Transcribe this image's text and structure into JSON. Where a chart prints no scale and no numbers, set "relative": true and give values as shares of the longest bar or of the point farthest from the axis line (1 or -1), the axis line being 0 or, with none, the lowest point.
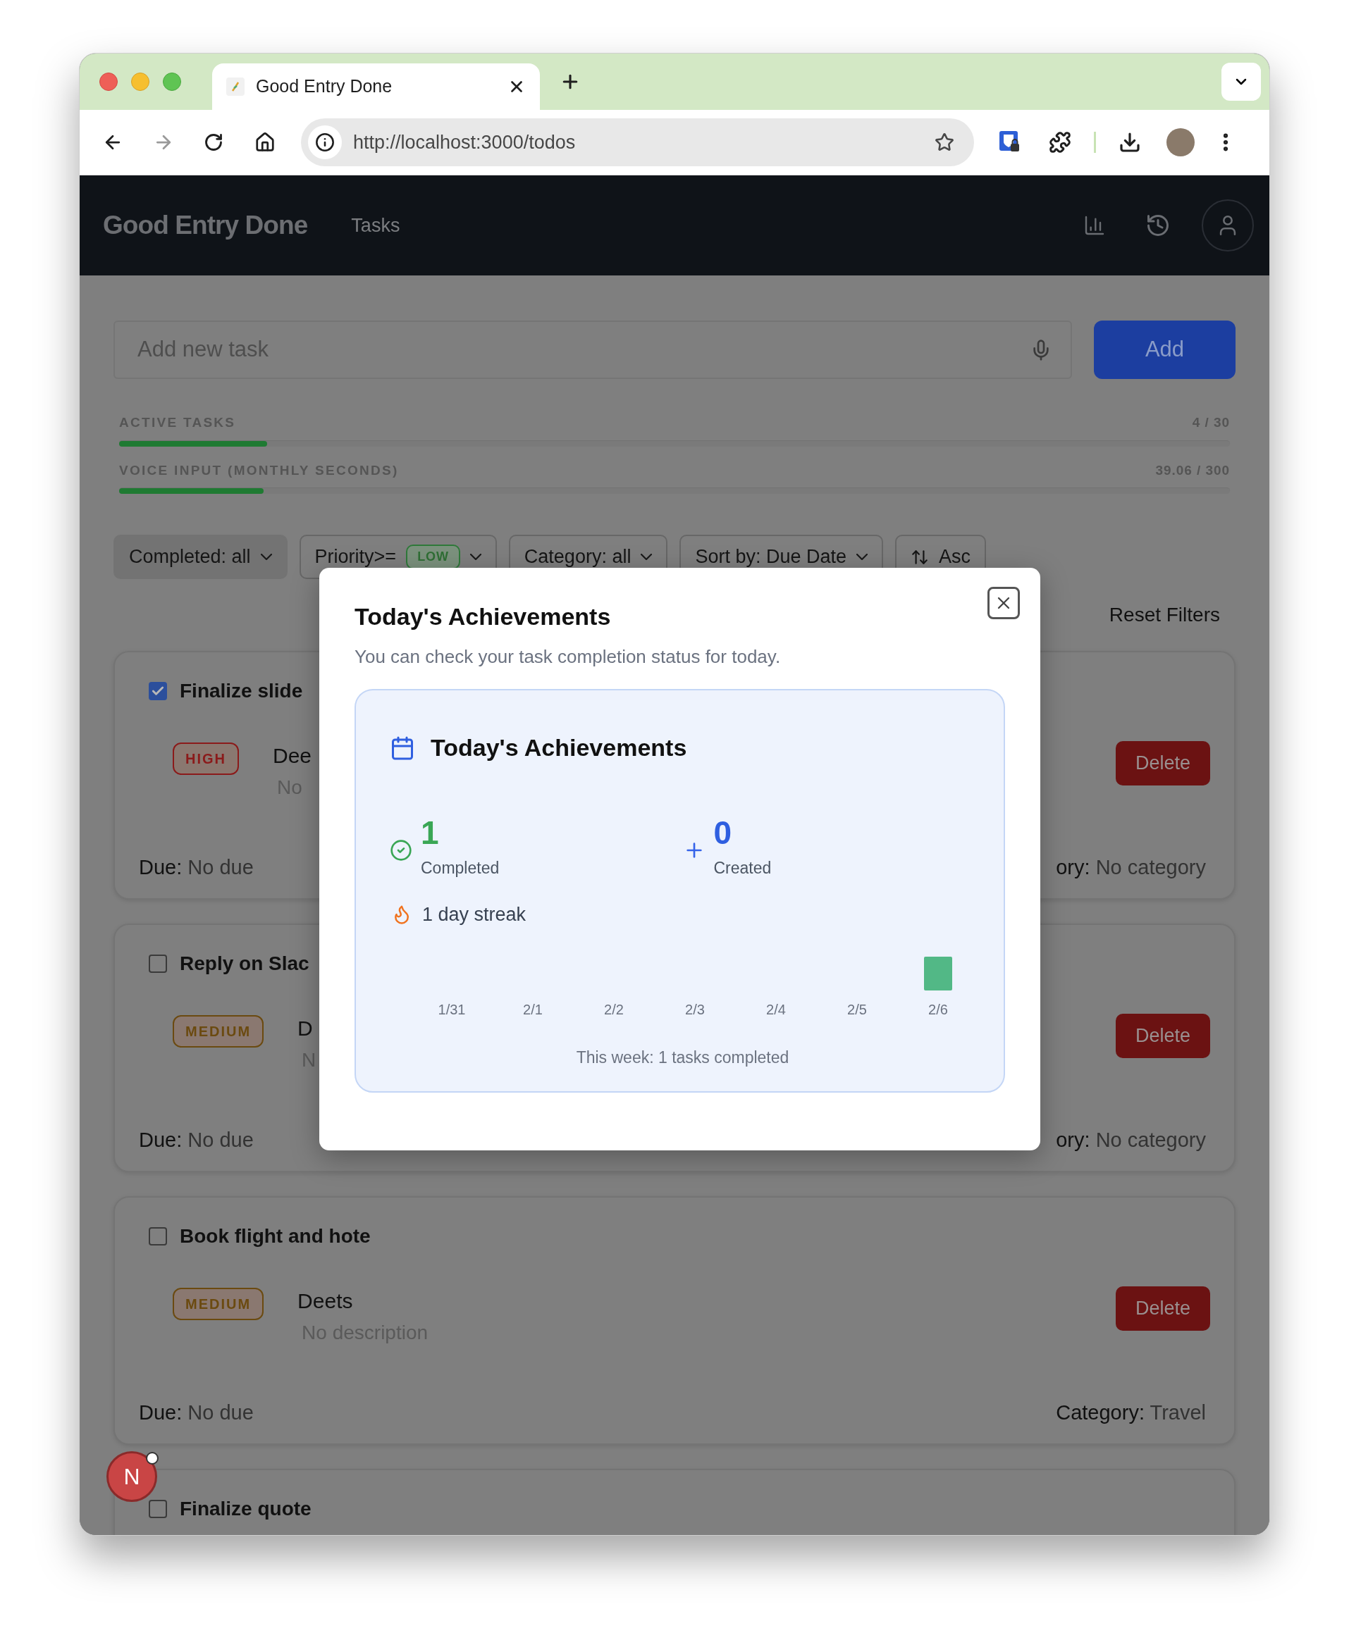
{
  "browser": {
    "tab_title": "Good Entry Done",
    "url": "http://localhost:3000/todos"
  },
  "header": {
    "logo": "Good Entry Done",
    "nav": [
      {
        "label": "Tasks"
      }
    ]
  },
  "new_task": {
    "placeholder": "Add new task",
    "button": "Add"
  },
  "quotas": [
    {
      "label": "ACTIVE TASKS",
      "reading": "4 / 30",
      "level": 0.133
    },
    {
      "label": "VOICE INPUT (MONTHLY SECONDS)",
      "reading": "39.06 / 300",
      "level": 0.13
    }
  ],
  "filters": [
    {
      "kind": "select",
      "label": "Completed:  all",
      "filled": true
    },
    {
      "kind": "badge_select",
      "label": "Priority>=",
      "badge": "LOW",
      "filled": false
    },
    {
      "kind": "select",
      "label": "Category: all",
      "filled": false
    },
    {
      "kind": "select",
      "label": "Sort by: Due Date",
      "filled": false
    },
    {
      "kind": "sort",
      "label": "Asc",
      "filled": false
    }
  ],
  "reset_filters": "Reset Filters",
  "tasks": [
    {
      "title": "Finalize slide",
      "checked": true,
      "priority": "HIGH",
      "color": "#8b1a1a",
      "name": "Dee",
      "description": "No",
      "due": "**Due:** No due",
      "category": "**ory:** No category",
      "action": "Delete"
    },
    {
      "title": "Reply on Slac",
      "checked": false,
      "priority": "MEDIUM",
      "color": "#6b4a10",
      "name": "D",
      "description": "N",
      "due": "**Due:** No due",
      "category": "**ory:** No category",
      "action": "Delete"
    },
    {
      "title": "Book flight and hote",
      "checked": false,
      "priority": "MEDIUM",
      "color": "#6b4a10",
      "name": "Deets",
      "description": "No description",
      "due": "**Due:** No due",
      "category": "**Category:** Travel",
      "action": "Delete"
    },
    {
      "title": "Finalize quote",
      "checked": false
    }
  ],
  "dev_badge": {
    "letter": "N"
  },
  "modal": {
    "title": "Today's Achievements",
    "subtitle": "You can check your task completion status for today.",
    "panel": {
      "title": "Today's Achievements",
      "stats": [
        {
          "kind": "completed",
          "value": "1",
          "label": "Completed"
        },
        {
          "kind": "created",
          "value": "0",
          "label": "Created"
        }
      ],
      "streak": "1 day streak",
      "chart_data": {
        "type": "bar",
        "relative": true,
        "categories": [
          "1/31",
          "2/1",
          "2/2",
          "2/3",
          "2/4",
          "2/5",
          "2/6"
        ],
        "values": [
          0,
          0,
          0,
          0,
          0,
          0,
          1
        ]
      },
      "summary": "This week: 1 tasks completed"
    }
  }
}
